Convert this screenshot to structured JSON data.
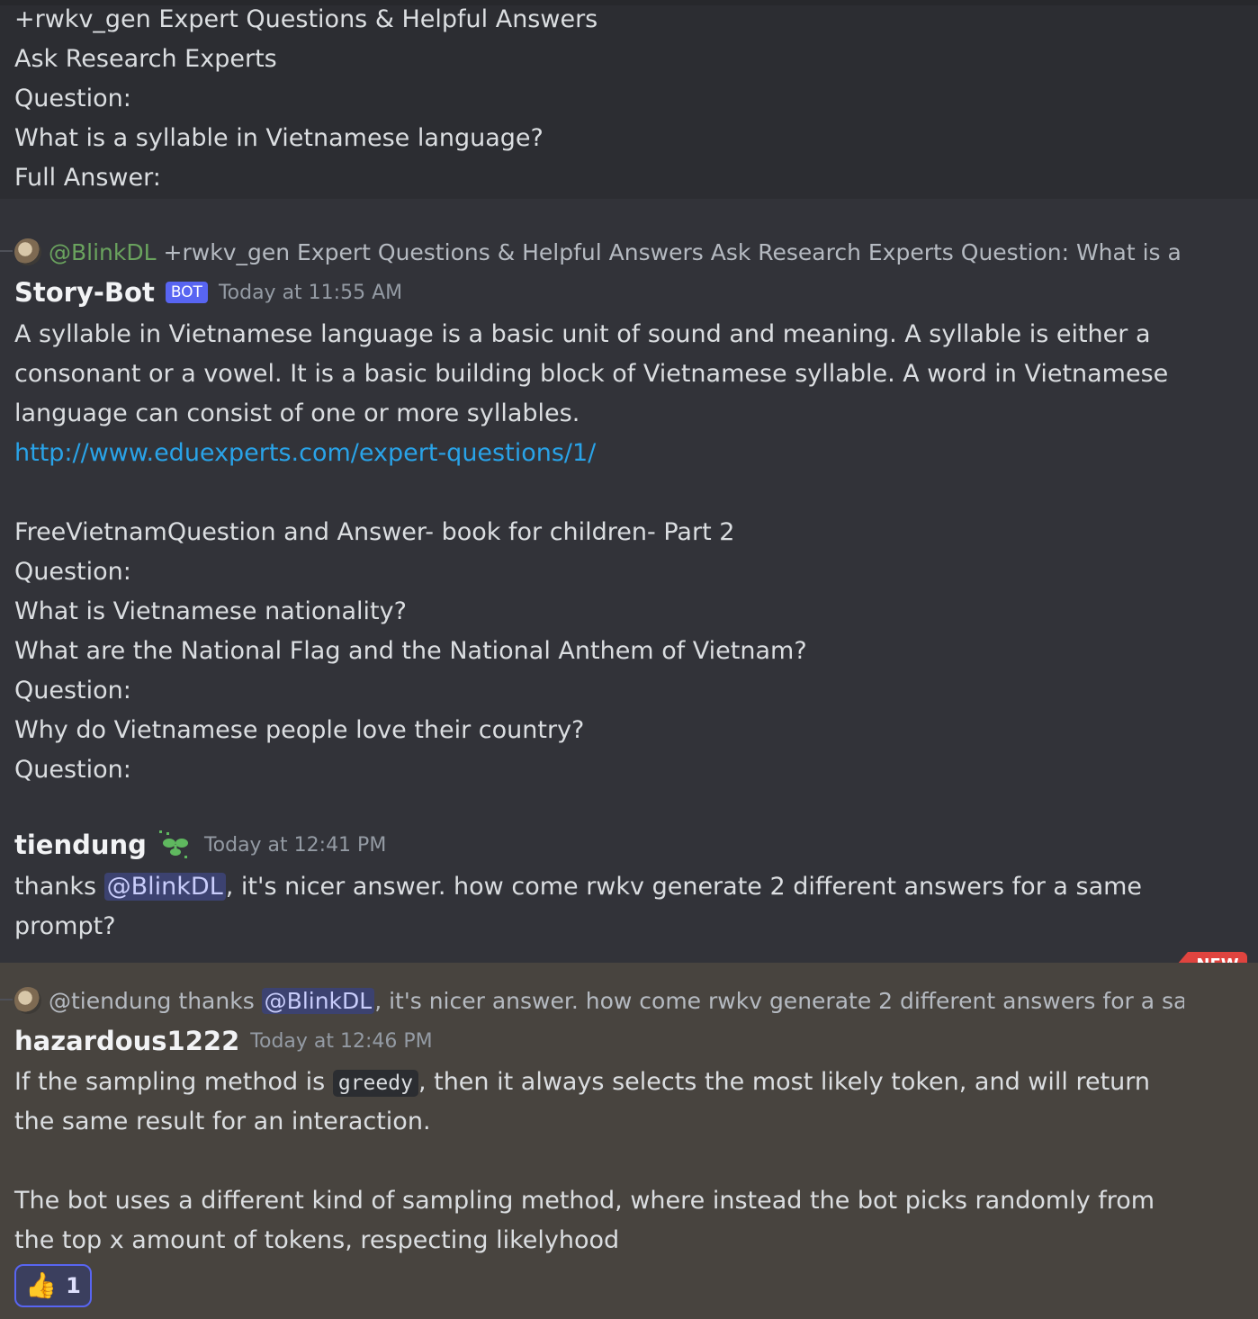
{
  "prompt_message": {
    "lines": [
      "+rwkv_gen Expert Questions & Helpful Answers",
      "Ask Research Experts",
      "Question:",
      "What is a syllable in Vietnamese language?",
      "Full Answer:"
    ]
  },
  "bot_reply": {
    "reply_to": {
      "user": "@BlinkDL",
      "text": "+rwkv_gen Expert Questions & Helpful Answers Ask Research Experts Question: What is a syllab"
    },
    "author": "Story-Bot",
    "tag": "BOT",
    "timestamp": "Today at 11:55 AM",
    "lines": [
      "A syllable in Vietnamese language is a basic unit of sound and meaning. A syllable is either a",
      "consonant or a vowel. It is a basic building block of Vietnamese syllable. A word in Vietnamese",
      "language can consist of one or more syllables."
    ],
    "link": "http://www.eduexperts.com/expert-questions/1/",
    "lines2": [
      "FreeVietnamQuestion and Answer- book for children- Part 2",
      "Question:",
      "What is Vietnamese nationality?",
      "What are the National Flag and the National Anthem of Vietnam?",
      "Question:",
      "Why do Vietnamese people love their country?",
      "Question:"
    ]
  },
  "tiendung_message": {
    "author": "tiendung",
    "timestamp": "Today at 12:41 PM",
    "text_before": "thanks ",
    "mention": "@BlinkDL",
    "text_after": ", it's nicer answer. how come rwkv generate 2 different answers for a same",
    "line2": "prompt?"
  },
  "divider": {
    "badge": "NEW"
  },
  "hazardous_message": {
    "reply_to": {
      "user": "@tiendung",
      "text_before": "thanks ",
      "mention": "@BlinkDL",
      "text_after": ", it's nicer answer. how come rwkv generate 2 different answers for a same pr"
    },
    "author": "hazardous1222",
    "timestamp": "Today at 12:46 PM",
    "p1_before": "If the sampling method is ",
    "p1_code": "greedy",
    "p1_after": ", then it always selects the most likely token, and will return",
    "p1_line2": "the same result for an interaction.",
    "p2_line1": "The bot uses a different kind of sampling method, where instead the bot picks randomly from",
    "p2_line2": "the top x amount of tokens, respecting likelyhood",
    "reaction": {
      "emoji": "👍",
      "count": "1"
    }
  },
  "colors": {
    "link": "#29a3e8",
    "mention_bg": "#3c4270",
    "new_divider": "#e04a4a",
    "bot_tag": "#5865f2"
  }
}
